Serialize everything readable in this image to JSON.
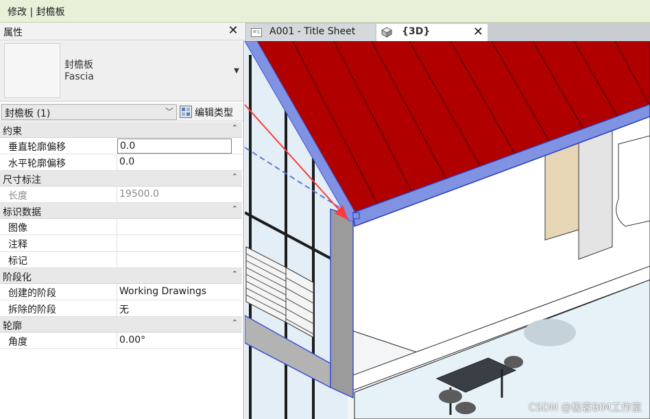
{
  "ribbon": {
    "context_label": "修改 | 封檐板"
  },
  "properties": {
    "title": "属性",
    "type_selector": {
      "family": "封檐板",
      "type": "Fascia"
    },
    "instance_filter": "封檐板 (1)",
    "edit_type_label": "编辑类型",
    "groups": [
      {
        "label": "约束",
        "rows": [
          {
            "name": "垂直轮廓偏移",
            "value": "0.0"
          },
          {
            "name": "水平轮廓偏移",
            "value": "0.0"
          }
        ]
      },
      {
        "label": "尺寸标注",
        "rows": [
          {
            "name": "长度",
            "value": "19500.0"
          }
        ]
      },
      {
        "label": "标识数据",
        "rows": [
          {
            "name": "图像",
            "value": ""
          },
          {
            "name": "注释",
            "value": ""
          },
          {
            "name": "标记",
            "value": ""
          }
        ]
      },
      {
        "label": "阶段化",
        "rows": [
          {
            "name": "创建的阶段",
            "value": "Working Drawings"
          },
          {
            "name": "拆除的阶段",
            "value": "无"
          }
        ]
      },
      {
        "label": "轮廓",
        "rows": [
          {
            "name": "角度",
            "value": "0.00°"
          }
        ]
      }
    ]
  },
  "tabs": [
    {
      "label": "A001 - Title Sheet",
      "icon": "sheet-icon"
    },
    {
      "label": "{3D}",
      "icon": "3d-view-icon"
    }
  ],
  "watermark": "CSDN @极客BIM工作室",
  "colors": {
    "roof": "#b00000",
    "fascia": "#7f93e2",
    "annotation_arrow": "#ff3b3b",
    "ribbon": "#e8f1d8"
  }
}
